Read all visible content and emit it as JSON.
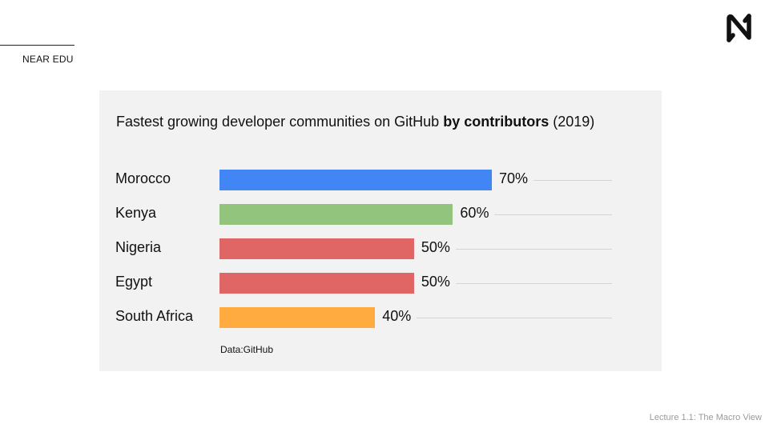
{
  "header": {
    "brand": "NEAR EDU"
  },
  "footer": {
    "lecture": "Lecture 1.1: The Macro View"
  },
  "chart_data": {
    "type": "bar",
    "orientation": "horizontal",
    "title": "Fastest growing developer communities on GitHub",
    "title_bold": "by contributors",
    "title_suffix": "(2019)",
    "source": "Data:GitHub",
    "categories": [
      "Morocco",
      "Kenya",
      "Nigeria",
      "Egypt",
      "South Africa"
    ],
    "values": [
      70,
      60,
      50,
      50,
      40
    ],
    "value_labels": [
      "70%",
      "60%",
      "50%",
      "50%",
      "40%"
    ],
    "colors": [
      "#4285f4",
      "#93c47d",
      "#e06666",
      "#e06666",
      "#ffab40"
    ],
    "xlim": [
      0,
      100
    ],
    "grid": false
  }
}
